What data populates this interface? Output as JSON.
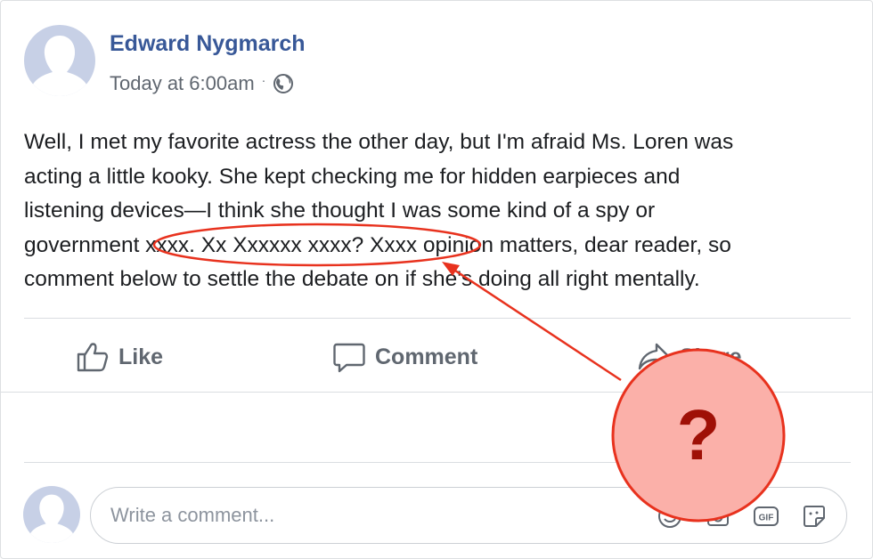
{
  "post": {
    "author": "Edward Nygmarch",
    "timestamp": "Today at 6:00am",
    "separator": "·",
    "privacy_icon": "globe-icon",
    "text_lines": [
      "Well, I met my favorite actress the other day, but I'm afraid Ms. Loren was",
      "acting a little kooky. She kept checking me for hidden earpieces and",
      "listening devices—I think she thought I was some kind of a spy or",
      "government xxxx. Xx Xxxxxx xxxx? Xxxx opinion matters, dear reader, so",
      "comment below to settle the debate on if she's doing all right mentally."
    ]
  },
  "actions": {
    "like_label": "Like",
    "comment_label": "Comment",
    "share_label": "Share"
  },
  "comment_box": {
    "placeholder": "Write a comment...",
    "icons": [
      "emoji-icon",
      "camera-icon",
      "gif-icon",
      "sticker-icon"
    ],
    "gif_text": "GIF"
  },
  "annotation": {
    "marker": "?",
    "color_fill": "#fbb0a9",
    "color_stroke": "#e8321e",
    "color_text": "#9f1006"
  },
  "colors": {
    "author": "#385898",
    "text": "#1c1e21",
    "secondary": "#606770"
  }
}
